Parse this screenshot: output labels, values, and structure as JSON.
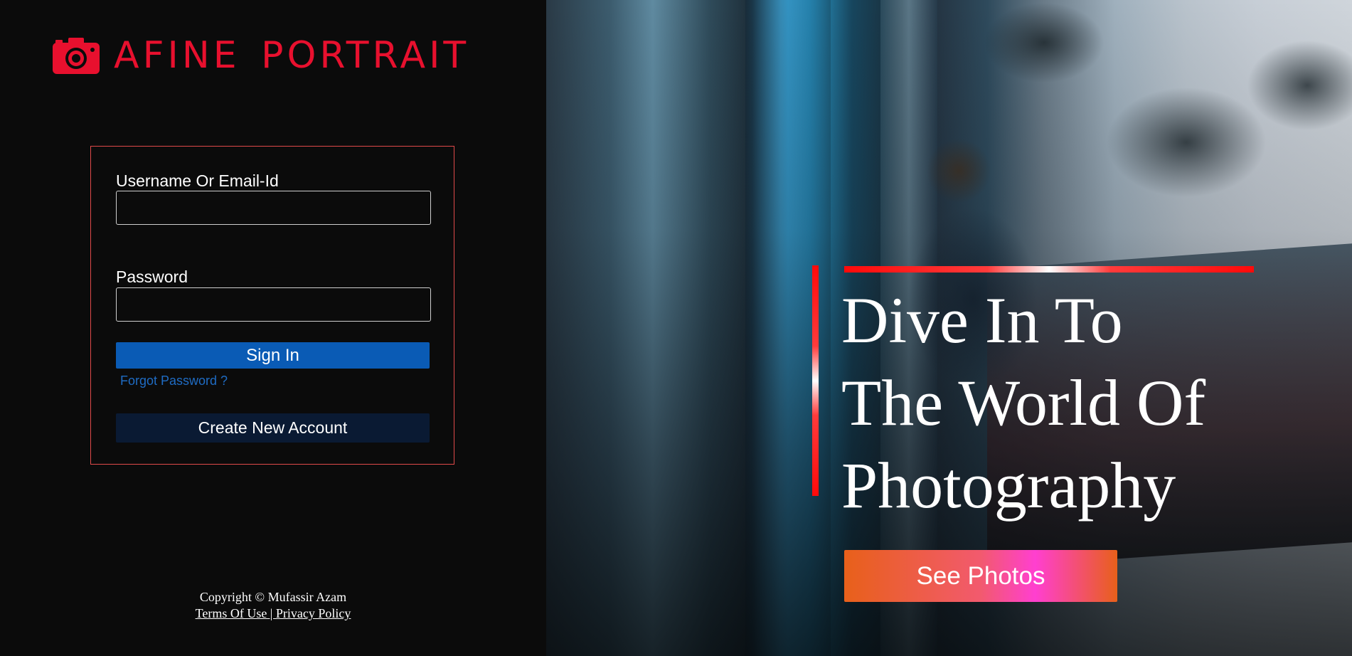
{
  "brand": {
    "name": "AFINE PORTRAIT",
    "color": "#e8102e",
    "icon": "camera-icon"
  },
  "login": {
    "username_label": "Username Or Email-Id",
    "username_value": "",
    "password_label": "Password",
    "password_value": "",
    "signin_label": "Sign In",
    "forgot_label": "Forgot Password ?",
    "create_label": "Create New Account"
  },
  "footer": {
    "copyright": "Copyright © Mufassir Azam",
    "links_text": "Terms Of Use | Privacy Policy"
  },
  "hero": {
    "headline_lines": [
      "Dive In To",
      "The World Of",
      "Photography"
    ],
    "cta_label": "See Photos"
  },
  "colors": {
    "signin_button": "#0a5bb5",
    "create_button": "#0a1a33",
    "accent_red": "#ff0a0a",
    "box_border": "#e04a4a"
  }
}
